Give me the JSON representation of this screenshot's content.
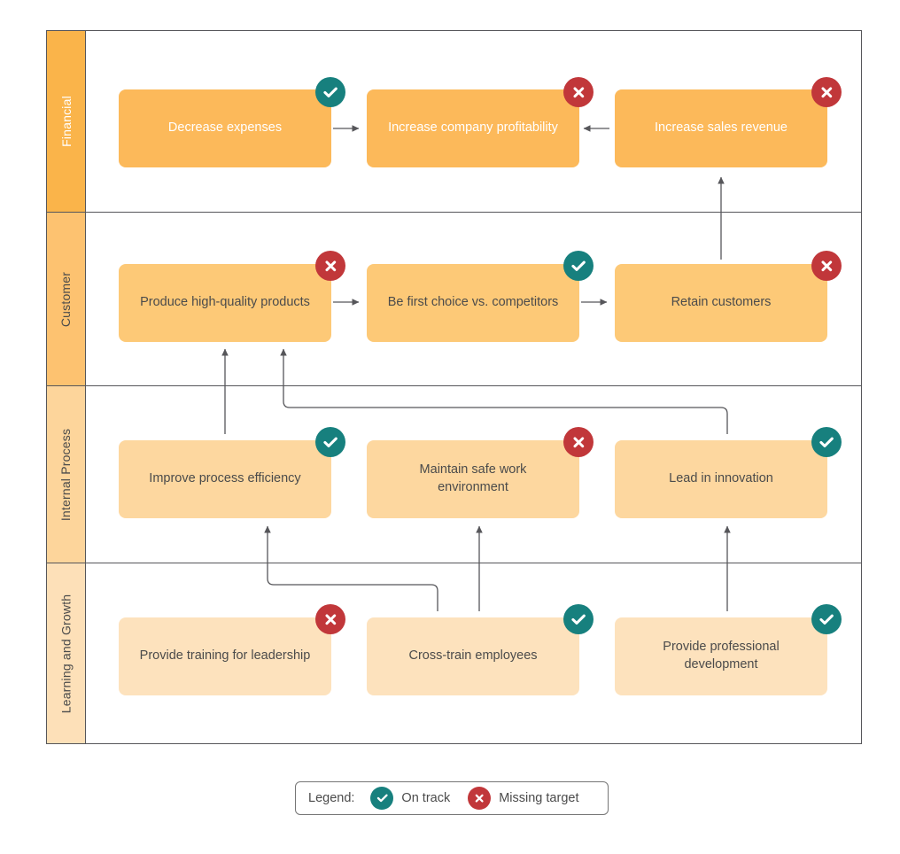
{
  "colors": {
    "ok": "#17807e",
    "miss": "#c1373a",
    "lane_border": "#56565a",
    "connector": "#56565a",
    "financial_fill": "#fcb95a",
    "financial_label": "#fab44a",
    "customer_fill": "#fdc977",
    "customer_label": "#fdc270",
    "internal_fill": "#fdd79f",
    "internal_label": "#fdd59b",
    "learning_fill": "#fde2bd",
    "learning_label": "#fde0b8",
    "text_light": "#ffffff",
    "text_dark": "#4b4b4b"
  },
  "lanes": [
    {
      "id": "financial",
      "label": "Financial",
      "label_color": "#ffffff",
      "cards": [
        {
          "id": "decrease-expenses",
          "label": "Decrease expenses",
          "status": "ok"
        },
        {
          "id": "increase-company-profitability",
          "label": "Increase company profitability",
          "status": "miss"
        },
        {
          "id": "increase-sales-revenue",
          "label": "Increase sales revenue",
          "status": "miss"
        }
      ]
    },
    {
      "id": "customer",
      "label": "Customer",
      "label_color": "#4b4b4b",
      "cards": [
        {
          "id": "produce-high-quality-products",
          "label": "Produce high-quality products",
          "status": "miss"
        },
        {
          "id": "be-first-choice",
          "label": "Be first choice vs. competitors",
          "status": "ok"
        },
        {
          "id": "retain-customers",
          "label": "Retain customers",
          "status": "miss"
        }
      ]
    },
    {
      "id": "internal-process",
      "label": "Internal Process",
      "label_color": "#4b4b4b",
      "cards": [
        {
          "id": "improve-process-efficiency",
          "label": "Improve process efficiency",
          "status": "ok"
        },
        {
          "id": "maintain-safe-work-environment",
          "label": "Maintain safe work environment",
          "status": "miss"
        },
        {
          "id": "lead-in-innovation",
          "label": "Lead in innovation",
          "status": "ok"
        }
      ]
    },
    {
      "id": "learning-and-growth",
      "label": "Learning and Growth",
      "label_color": "#4b4b4b",
      "cards": [
        {
          "id": "provide-training-for-leadership",
          "label": "Provide training for leadership",
          "status": "miss"
        },
        {
          "id": "cross-train-employees",
          "label": "Cross-train employees",
          "status": "ok"
        },
        {
          "id": "provide-professional-development",
          "label": "Provide professional development",
          "status": "ok"
        }
      ]
    }
  ],
  "legend": {
    "title": "Legend:",
    "on_track": "On track",
    "missing_target": "Missing target"
  }
}
